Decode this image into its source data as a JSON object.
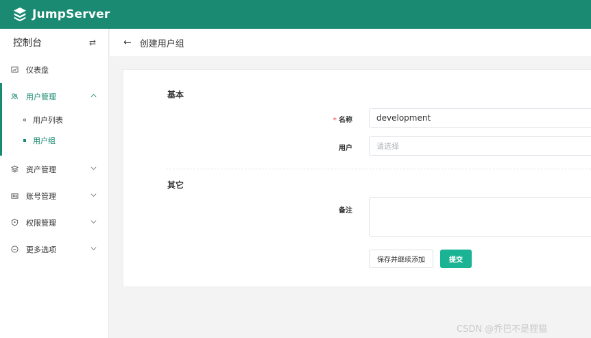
{
  "app": {
    "brand": "JumpServer",
    "accent_color": "#1a8a72",
    "primary_button_color": "#1ab394"
  },
  "sidebar": {
    "title": "控制台",
    "swap_icon": "⇄",
    "items": [
      {
        "label": "仪表盘",
        "icon": "dashboard-icon"
      },
      {
        "label": "用户管理",
        "icon": "users-icon",
        "expanded": true,
        "children": [
          {
            "label": "用户列表"
          },
          {
            "label": "用户组",
            "active": true
          }
        ]
      },
      {
        "label": "资产管理",
        "icon": "assets-icon"
      },
      {
        "label": "账号管理",
        "icon": "accounts-icon"
      },
      {
        "label": "权限管理",
        "icon": "permissions-icon"
      },
      {
        "label": "更多选项",
        "icon": "more-options-icon"
      }
    ]
  },
  "header": {
    "back_icon": "←",
    "title": "创建用户组"
  },
  "form": {
    "section_basic": "基本",
    "name_label": "名称",
    "name_required_mark": "*",
    "name_value": "development",
    "users_label": "用户",
    "users_placeholder": "请选择",
    "section_other": "其它",
    "comment_label": "备注",
    "save_continue_label": "保存并继续添加",
    "submit_label": "提交"
  },
  "watermark": "CSDN @乔巴不是狸猫"
}
